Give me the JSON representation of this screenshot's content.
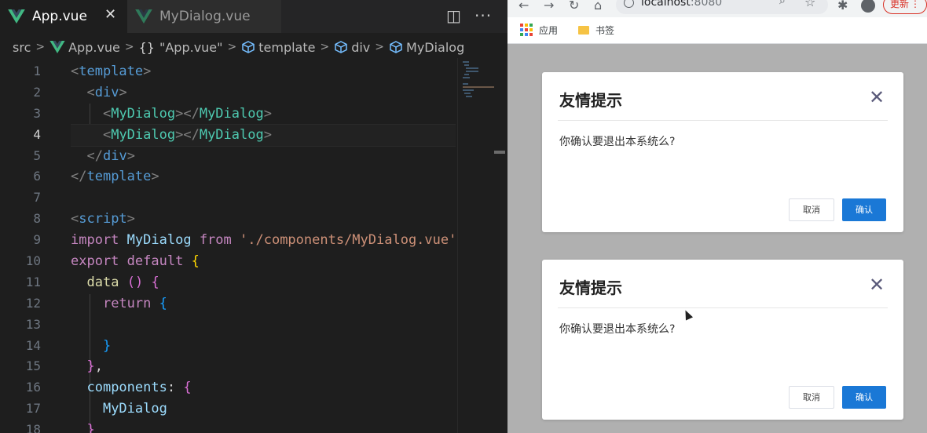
{
  "editor": {
    "tabs": [
      {
        "label": "App.vue",
        "active": true,
        "icon": "vue-icon"
      },
      {
        "label": "MyDialog.vue",
        "active": false,
        "icon": "vue-icon"
      }
    ],
    "breadcrumb": [
      {
        "label": "src"
      },
      {
        "label": "App.vue",
        "icon": "vue-icon"
      },
      {
        "label": "\"App.vue\"",
        "icon": "braces-icon"
      },
      {
        "label": "template",
        "icon": "cube-icon"
      },
      {
        "label": "div",
        "icon": "cube-icon"
      },
      {
        "label": "MyDialog",
        "icon": "cube-icon"
      }
    ],
    "line_numbers": [
      "1",
      "2",
      "3",
      "4",
      "5",
      "6",
      "7",
      "8",
      "9",
      "10",
      "11",
      "12",
      "13",
      "14",
      "15",
      "16",
      "17",
      "18"
    ],
    "current_line": 4,
    "code_lines": [
      "<template>",
      "  <div>",
      "    <MyDialog></MyDialog>",
      "    <MyDialog></MyDialog>",
      "  </div>",
      "</template>",
      "",
      "<script>",
      "import MyDialog from './components/MyDialog.vue'",
      "export default {",
      "  data () {",
      "    return {",
      "",
      "    }",
      "  },",
      "  components: {",
      "    MyDialog",
      "  }"
    ],
    "colors": {
      "background": "#1e1e1e",
      "tag": "#569cd6",
      "component": "#4ec9b0",
      "keyword": "#c586c0",
      "string": "#ce9178"
    }
  },
  "browser": {
    "url_host": "localhost",
    "url_port": ":8080",
    "bookmarks": [
      {
        "label": "应用",
        "icon": "apps-grid-icon"
      },
      {
        "label": "书签",
        "icon": "folder-icon"
      }
    ],
    "update_label": "更新",
    "dialogs": [
      {
        "title": "友情提示",
        "message": "你确认要退出本系统么?",
        "cancel_label": "取消",
        "confirm_label": "确认"
      },
      {
        "title": "友情提示",
        "message": "你确认要退出本系统么?",
        "cancel_label": "取消",
        "confirm_label": "确认"
      }
    ],
    "colors": {
      "page_background": "#b0b0b0",
      "confirm_button": "#1a78d6",
      "close_icon": "#5a5a7a"
    }
  }
}
